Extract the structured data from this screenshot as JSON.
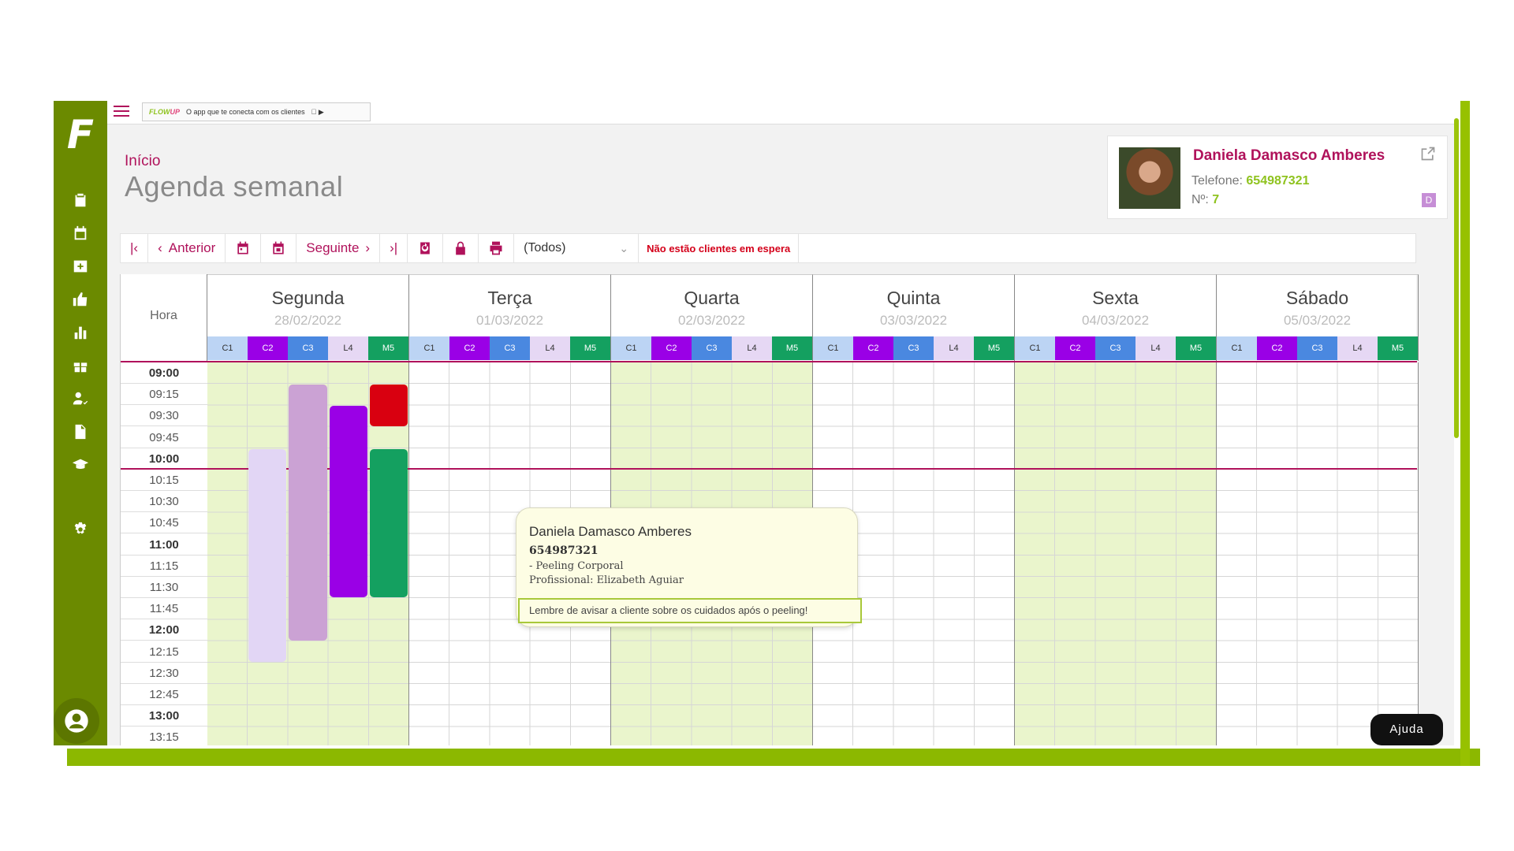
{
  "promo": {
    "brand": "FLOW",
    "brand_suffix": "UP",
    "text": "O app que te conecta com os clientes"
  },
  "breadcrumb": "Início",
  "page_title": "Agenda semanal",
  "client": {
    "name": "Daniela Damasco Amberes",
    "phone_label": "Telefone:",
    "phone": "654987321",
    "num_label": "Nº:",
    "num": "7",
    "badge": "D"
  },
  "toolbar": {
    "prev": "Anterior",
    "next": "Seguinte",
    "filter": "(Todos)",
    "warning": "Não estão clientes em espera"
  },
  "calendar": {
    "hour_header": "Hora",
    "days": [
      {
        "name": "Segunda",
        "date": "28/02/2022"
      },
      {
        "name": "Terça",
        "date": "01/03/2022"
      },
      {
        "name": "Quarta",
        "date": "02/03/2022"
      },
      {
        "name": "Quinta",
        "date": "03/03/2022"
      },
      {
        "name": "Sexta",
        "date": "04/03/2022"
      },
      {
        "name": "Sábado",
        "date": "05/03/2022"
      }
    ],
    "resources": [
      {
        "label": "C1",
        "color": "#bcd4f4"
      },
      {
        "label": "C2",
        "color": "#9a00e6"
      },
      {
        "label": "C3",
        "color": "#4a88e0"
      },
      {
        "label": "L4",
        "color": "#e6d8f4"
      },
      {
        "label": "M5",
        "color": "#14a060"
      }
    ],
    "times": [
      "09:00",
      "09:15",
      "09:30",
      "09:45",
      "10:00",
      "10:15",
      "10:30",
      "10:45",
      "11:00",
      "11:15",
      "11:30",
      "11:45",
      "12:00",
      "12:15",
      "12:30",
      "12:45",
      "13:00",
      "13:15"
    ]
  },
  "tooltip": {
    "name": "Daniela Damasco Amberes",
    "phone": "654987321",
    "service": "- Peeling Corporal",
    "professional": "Profissional: Elizabeth Aguiar",
    "note": "Lembre de avisar a cliente sobre os cuidados após o peeling!"
  },
  "help": "Ajuda"
}
